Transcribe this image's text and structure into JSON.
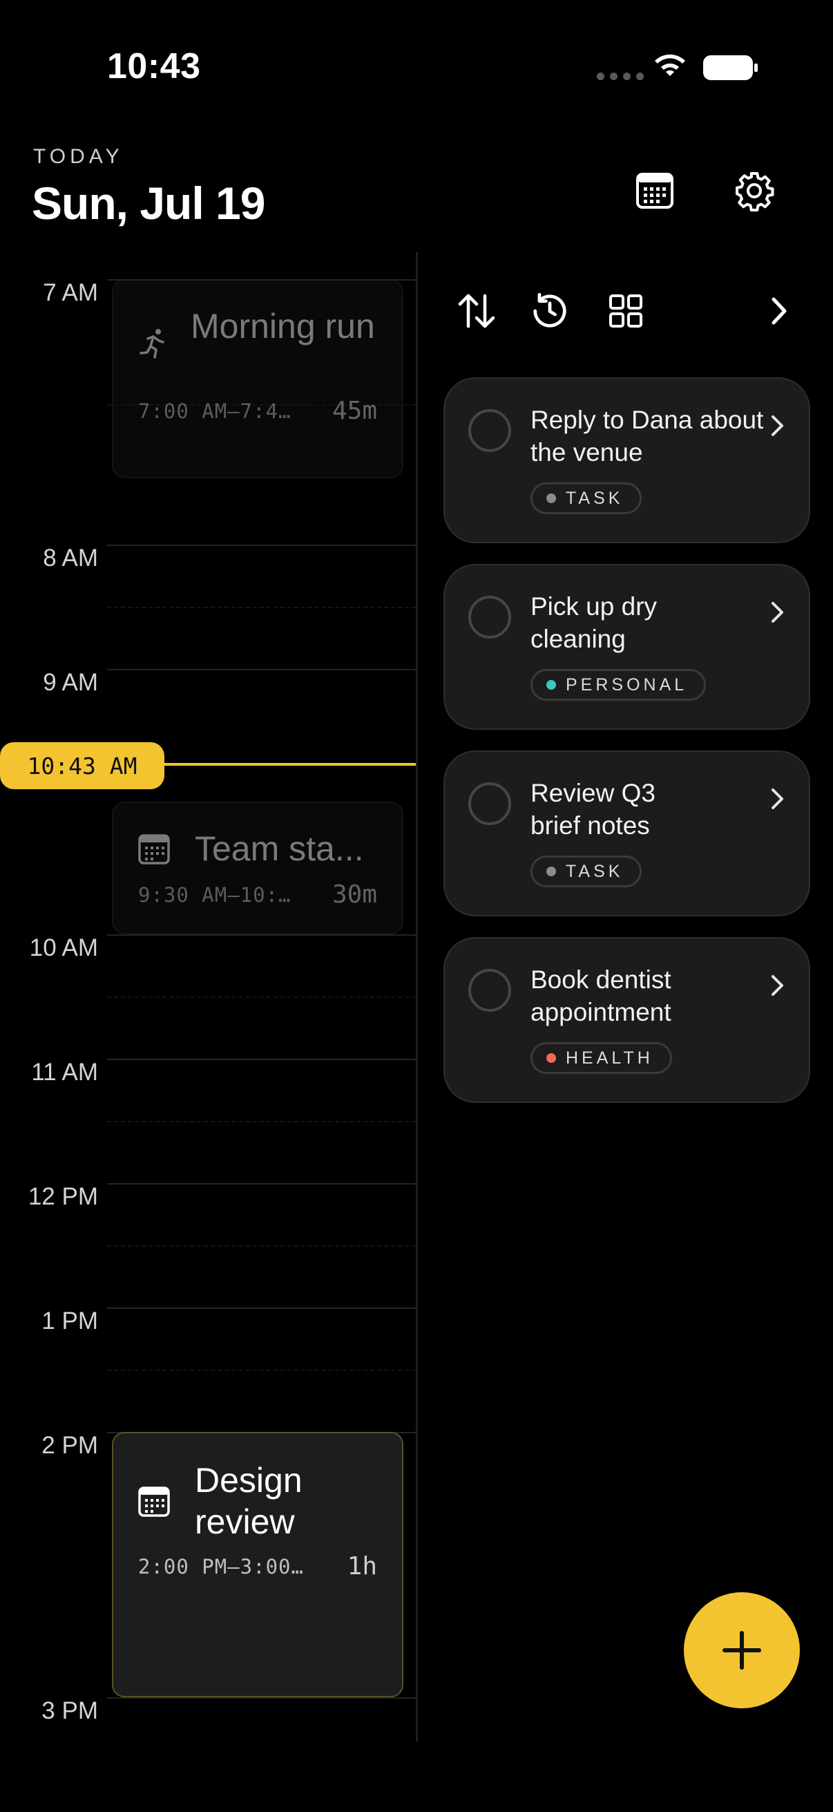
{
  "status_bar": {
    "time": "10:43"
  },
  "header": {
    "today_label": "TODAY",
    "date": "Sun, Jul 19"
  },
  "timeline": {
    "hours": [
      "7 AM",
      "8 AM",
      "9 AM",
      "10 AM",
      "11 AM",
      "12 PM",
      "1 PM",
      "2 PM",
      "3 PM"
    ],
    "now_badge": "10:43 AM",
    "events": [
      {
        "title": "Morning run",
        "time": "7:00 AM–7:4…",
        "duration": "45m",
        "icon": "running-icon"
      },
      {
        "title": "Team sta...",
        "time": "9:30 AM–10:…",
        "duration": "30m",
        "icon": "calendar-icon"
      },
      {
        "title": "Design review",
        "time": "2:00 PM–3:00…",
        "duration": "1h",
        "icon": "calendar-icon"
      }
    ]
  },
  "tasks": [
    {
      "title": "Reply to Dana about the venue",
      "tag": "TASK",
      "tag_color": "#8c8c8c"
    },
    {
      "title": "Pick up dry cleaning",
      "tag": "PERSONAL",
      "tag_color": "#3ec7c0"
    },
    {
      "title": "Review Q3 brief notes",
      "tag": "TASK",
      "tag_color": "#8c8c8c"
    },
    {
      "title": "Book dentist appointment",
      "tag": "HEALTH",
      "tag_color": "#f06a55"
    }
  ],
  "colors": {
    "accent": "#f4c430",
    "background": "#000000"
  }
}
